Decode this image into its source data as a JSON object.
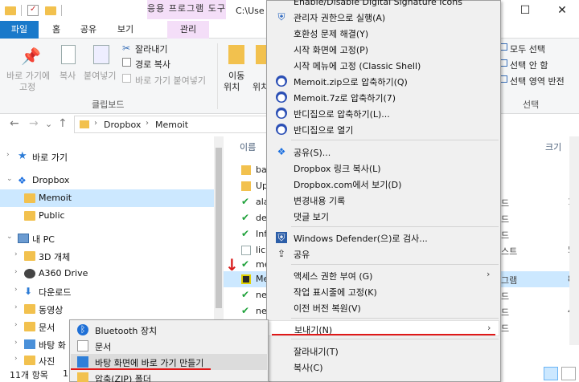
{
  "titlebar": {
    "context_tab_header": "응용 프로그램 도구",
    "path_text": "C:\\Use",
    "controls": {
      "minimize": "—",
      "maximize": "☐",
      "close": "✕"
    }
  },
  "ribbon_tabs": [
    "파일",
    "홈",
    "공유",
    "보기",
    "관리"
  ],
  "ribbon": {
    "pin_quick": [
      "바로 가기에",
      "고정"
    ],
    "copy": "복사",
    "paste": "붙여넣기",
    "cut": "잘라내기",
    "copy_path": "경로 복사",
    "paste_shortcut": "바로 가기 붙여넣기",
    "clipboard_group": "클립보드",
    "move_to": [
      "이동",
      "위치"
    ],
    "copy_to": "위치",
    "select_all": "모두 선택",
    "select_none": "선택 안 함",
    "invert_selection": "선택 영역 반전",
    "select_group": "선택"
  },
  "address": {
    "crumbs": [
      "Dropbox",
      "Memoit"
    ],
    "back": "←",
    "forward": "→",
    "down": "⌄",
    "up": "↑"
  },
  "nav_pane": [
    {
      "label": "바로 가기",
      "icon": "star-icon"
    },
    {
      "label": "Dropbox",
      "icon": "dropbox-icon"
    },
    {
      "label": "Memoit",
      "icon": "folder-icon"
    },
    {
      "label": "Public",
      "icon": "folder-icon"
    },
    {
      "label": "내 PC",
      "icon": "pc-icon"
    },
    {
      "label": "3D 개체",
      "icon": "folder-icon"
    },
    {
      "label": "A360 Drive",
      "icon": "drive-icon"
    },
    {
      "label": "다운로드",
      "icon": "download-icon"
    },
    {
      "label": "동영상",
      "icon": "video-icon"
    },
    {
      "label": "문서",
      "icon": "folder-icon"
    },
    {
      "label": "바탕 화",
      "icon": "folder-icon"
    },
    {
      "label": "사진",
      "icon": "folder-icon"
    }
  ],
  "file_list": {
    "col_name": "이름",
    "col_size": "크기",
    "rows": [
      {
        "name": "ba",
        "type": "",
        "size": ""
      },
      {
        "name": "Up",
        "type": "",
        "size": ""
      },
      {
        "name": "ala",
        "type": "드",
        "size": "11"
      },
      {
        "name": "de",
        "type": "드",
        "size": ""
      },
      {
        "name": "Inf",
        "type": "드",
        "size": ""
      },
      {
        "name": "lic",
        "type": "스트",
        "size": "5"
      },
      {
        "name": "me",
        "type": "",
        "size": ""
      },
      {
        "name": "Me",
        "type": "그램",
        "size": "84"
      },
      {
        "name": "ne",
        "type": "드",
        "size": ""
      },
      {
        "name": "ne",
        "type": "드",
        "size": "4"
      },
      {
        "name": "ne",
        "type": "드",
        "size": ""
      }
    ]
  },
  "status": {
    "count": "11개 항목",
    "extra": "1"
  },
  "context_menu": [
    {
      "label": "Enable/Disable Digital Signature Icons",
      "icon": ""
    },
    {
      "label": "관리자 권한으로 실행(A)",
      "icon": "shield-icon"
    },
    {
      "label": "호환성 문제 해결(Y)",
      "icon": ""
    },
    {
      "label": "시작 화면에 고정(P)",
      "icon": ""
    },
    {
      "label": "시작 메뉴에 고정 (Classic Shell)",
      "icon": ""
    },
    {
      "label": "Memoit.zip으로 압축하기(Q)",
      "icon": "winrar-icon"
    },
    {
      "label": "Memoit.7z로 압축하기(7)",
      "icon": "winrar-icon"
    },
    {
      "label": "반디집으로 압축하기(L)...",
      "icon": "winrar-icon"
    },
    {
      "label": "반디집으로 열기",
      "icon": "winrar-icon"
    },
    {
      "label": "공유(S)...",
      "icon": "dropbox-icon"
    },
    {
      "label": "Dropbox 링크 복사(L)",
      "icon": ""
    },
    {
      "label": "Dropbox.com에서 보기(D)",
      "icon": ""
    },
    {
      "label": "변경내용 기록",
      "icon": ""
    },
    {
      "label": "댓글 보기",
      "icon": ""
    },
    {
      "label": "Windows Defender(으)로 검사...",
      "icon": "defender-icon"
    },
    {
      "label": "공유",
      "icon": "share-icon"
    },
    {
      "label": "액세스 권한 부여 (G)",
      "icon": ""
    },
    {
      "label": "작업 표시줄에 고정(K)",
      "icon": ""
    },
    {
      "label": "이전 버전 복원(V)",
      "icon": ""
    },
    {
      "label": "보내기(N)",
      "icon": ""
    },
    {
      "label": "잘라내기(T)",
      "icon": ""
    },
    {
      "label": "복사(C)",
      "icon": ""
    }
  ],
  "send_to_menu": [
    {
      "label": "Bluetooth 장치",
      "icon": "bluetooth-icon"
    },
    {
      "label": "문서",
      "icon": "document-icon"
    },
    {
      "label": "바탕 화면에 바로 가기 만들기",
      "icon": "desktop-icon"
    },
    {
      "label": "압축(ZIP) 폴더",
      "icon": "zip-folder-icon"
    }
  ],
  "colors": {
    "accent_blue": "#1979ca",
    "context_tab_pink": "#f4def8",
    "selection": "#cce8ff",
    "annotation_red": "#e01818"
  }
}
